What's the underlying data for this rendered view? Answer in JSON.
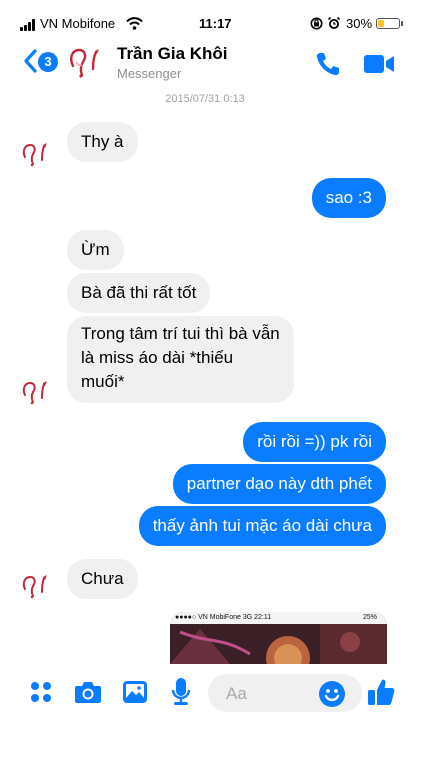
{
  "status_bar": {
    "carrier": "VN Mobifone",
    "time": "11:17",
    "battery_percent": "30%",
    "battery_level": 0.3
  },
  "header": {
    "back_badge_count": "3",
    "contact_name": "Trần Gia Khôi",
    "contact_subtitle": "Messenger",
    "icons": [
      "chevron-left-icon",
      "phone-icon",
      "video-camera-icon"
    ]
  },
  "conversation": {
    "date_stamp": "2015/07/31 0:13",
    "messages": [
      {
        "direction": "incoming",
        "text": "Thy à"
      },
      {
        "direction": "outgoing",
        "text": "sao :3"
      },
      {
        "direction": "incoming",
        "text": "Ừm"
      },
      {
        "direction": "incoming",
        "text": "Bà đã thi rất tốt"
      },
      {
        "direction": "incoming",
        "lines": [
          "Trong tâm trí tui thì bà vẫn",
          "là miss áo dài *thiếu",
          "muối*"
        ]
      },
      {
        "direction": "outgoing",
        "text": "rồi rồi =)) pk rồi"
      },
      {
        "direction": "outgoing",
        "text": "partner dạo này dth phết"
      },
      {
        "direction": "outgoing",
        "text": "thấy ảnh tui mặc áo dài chưa"
      },
      {
        "direction": "incoming",
        "text": "Chưa"
      }
    ],
    "image_preview": {
      "status_text_left": "●●●●○ VN MobiFone  3G  22:11",
      "status_text_right": "25%"
    }
  },
  "composer": {
    "placeholder": "Aa",
    "icons": [
      "apps-icon",
      "camera-icon",
      "photo-icon",
      "microphone-icon",
      "emoji-icon",
      "like-icon"
    ]
  },
  "colors": {
    "accent": "#0a7cff",
    "incoming_bubble": "#f1f0f0",
    "battery": "#f6c625"
  }
}
